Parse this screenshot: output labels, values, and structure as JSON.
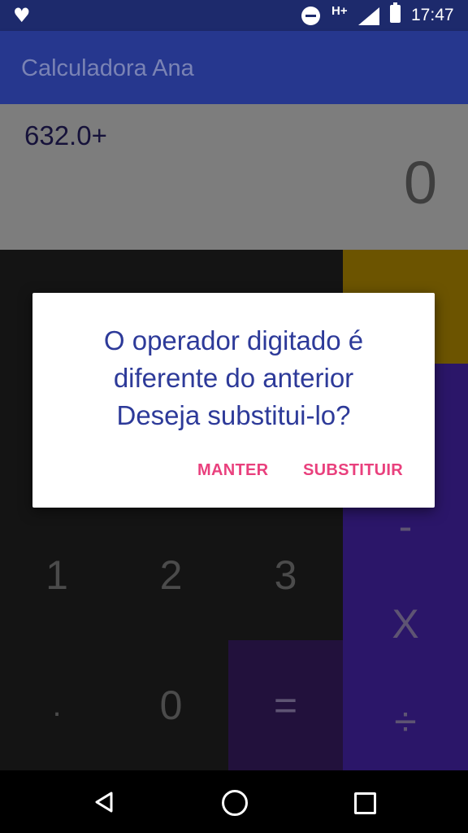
{
  "status_bar": {
    "network": "H+",
    "time": "17:47"
  },
  "app_bar": {
    "title": "Calculadora Ana"
  },
  "display": {
    "expression": "632.0+",
    "result": "0"
  },
  "keypad": {
    "row_1_2_3": [
      "1",
      "2",
      "3"
    ],
    "row_bottom": [
      ".",
      "0",
      "="
    ],
    "operators": {
      "minus": "-",
      "times": "X",
      "divide": "÷"
    }
  },
  "dialog": {
    "message_lines": [
      "O operador digitado é",
      "diferente do anterior",
      "Deseja substitui-lo?"
    ],
    "keep_label": "MANTER",
    "replace_label": "SUBSTITUIR"
  },
  "colors": {
    "status_bar": "#1d2a6c",
    "app_bar": "#26378e",
    "display_bg": "#7d7d7d",
    "keypad_bg": "#141414",
    "operator_bg": "#2b1669",
    "top_operator_bg": "#6c5400",
    "dialog_text": "#2d3a99",
    "dialog_button": "#e9407d"
  },
  "icons": [
    "heart-icon",
    "do-not-disturb-icon",
    "signal-icon",
    "battery-icon",
    "back-icon",
    "home-icon",
    "recents-icon"
  ]
}
